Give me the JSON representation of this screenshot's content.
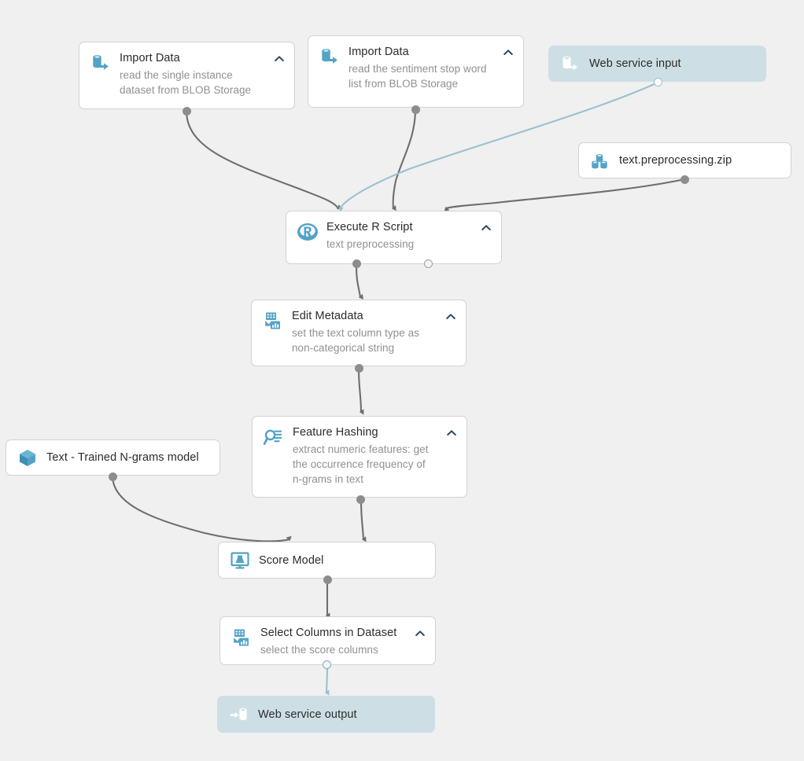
{
  "canvas": {
    "background": "#f0f0f0",
    "title": "Azure ML experiment canvas"
  },
  "colors": {
    "node_background": "#ffffff",
    "node_border": "#d2d2d2",
    "webservice_background": "#cddfe5",
    "icon_blue": "#53a3c6",
    "edge_gray": "#6e6e6e",
    "edge_blue": "#9bc0d2",
    "title_text": "#2b2b2b",
    "subtitle_text": "#909090",
    "port_filled": "#8d8d8d"
  },
  "nodes": [
    {
      "id": "import-data-1",
      "title": "Import Data",
      "subtitle": "read the single instance\ndataset from BLOB Storage",
      "subtitle_lines": [
        "read the single instance",
        "dataset from BLOB Storage"
      ],
      "icon": "import-data-icon",
      "kind": "standard",
      "collapsed": true,
      "chevron": "chevron-up-icon"
    },
    {
      "id": "import-data-2",
      "title": "Import Data",
      "subtitle": "read the sentiment stop word\nlist from BLOB Storage",
      "subtitle_lines": [
        "read the sentiment stop word",
        "list from BLOB Storage"
      ],
      "icon": "import-data-icon",
      "kind": "standard",
      "collapsed": true,
      "chevron": "chevron-up-icon"
    },
    {
      "id": "web-service-input",
      "title": "Web service input",
      "subtitle": "",
      "subtitle_lines": [],
      "icon": "web-service-input-icon",
      "kind": "webservice",
      "collapsed": false,
      "chevron": ""
    },
    {
      "id": "text-preprocessing-zip",
      "title": "text.preprocessing.zip",
      "subtitle": "",
      "subtitle_lines": [],
      "icon": "dataset-zip-icon",
      "kind": "standard",
      "collapsed": false,
      "chevron": ""
    },
    {
      "id": "execute-r-script",
      "title": "Execute R Script",
      "subtitle": "text preprocessing",
      "subtitle_lines": [
        "text preprocessing"
      ],
      "icon": "r-language-icon",
      "kind": "standard",
      "collapsed": true,
      "chevron": "chevron-up-icon"
    },
    {
      "id": "edit-metadata",
      "title": "Edit Metadata",
      "subtitle": "set the text column type as\nnon-categorical string",
      "subtitle_lines": [
        "set the text column type as",
        "non-categorical string"
      ],
      "icon": "edit-metadata-icon",
      "kind": "standard",
      "collapsed": true,
      "chevron": "chevron-up-icon"
    },
    {
      "id": "feature-hashing",
      "title": "Feature Hashing",
      "subtitle": "extract numeric features: get\nthe occurrence frequency of\nn-grams in text",
      "subtitle_lines": [
        "extract numeric features: get",
        "the occurrence frequency of",
        "n-grams in text"
      ],
      "icon": "feature-hashing-icon",
      "kind": "standard",
      "collapsed": true,
      "chevron": "chevron-up-icon"
    },
    {
      "id": "trained-model",
      "title": "Text - Trained N-grams model",
      "subtitle": "",
      "subtitle_lines": [],
      "icon": "trained-model-cube-icon",
      "kind": "standard",
      "collapsed": false,
      "chevron": ""
    },
    {
      "id": "score-model",
      "title": "Score Model",
      "subtitle": "",
      "subtitle_lines": [],
      "icon": "score-model-icon",
      "kind": "standard",
      "collapsed": false,
      "chevron": ""
    },
    {
      "id": "select-columns",
      "title": "Select Columns in Dataset",
      "subtitle": "select the score columns",
      "subtitle_lines": [
        "select the score columns"
      ],
      "icon": "select-columns-icon",
      "kind": "standard",
      "collapsed": true,
      "chevron": "chevron-up-icon"
    },
    {
      "id": "web-service-output",
      "title": "Web service output",
      "subtitle": "",
      "subtitle_lines": [],
      "icon": "web-service-output-icon",
      "kind": "webservice",
      "collapsed": false,
      "chevron": ""
    }
  ],
  "connections": [
    {
      "from": "import-data-1",
      "to": "execute-r-script",
      "color": "gray"
    },
    {
      "from": "import-data-2",
      "to": "execute-r-script",
      "color": "gray"
    },
    {
      "from": "web-service-input",
      "to": "execute-r-script",
      "color": "blue"
    },
    {
      "from": "text-preprocessing-zip",
      "to": "execute-r-script",
      "color": "gray"
    },
    {
      "from": "execute-r-script",
      "to": "edit-metadata",
      "color": "gray"
    },
    {
      "from": "edit-metadata",
      "to": "feature-hashing",
      "color": "gray"
    },
    {
      "from": "trained-model",
      "to": "score-model",
      "color": "gray"
    },
    {
      "from": "feature-hashing",
      "to": "score-model",
      "color": "gray"
    },
    {
      "from": "score-model",
      "to": "select-columns",
      "color": "gray"
    },
    {
      "from": "select-columns",
      "to": "web-service-output",
      "color": "blue"
    }
  ]
}
